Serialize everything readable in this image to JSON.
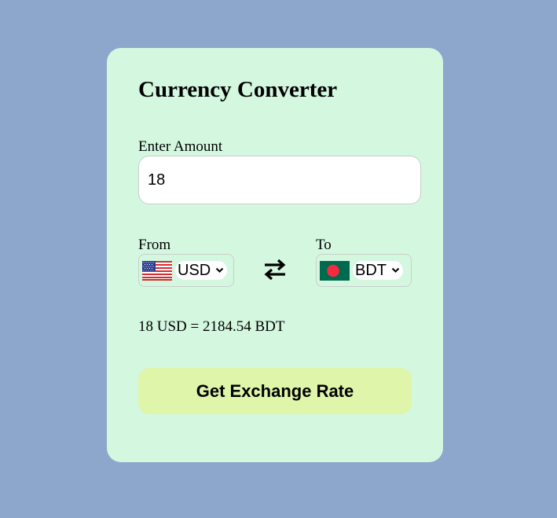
{
  "app": {
    "title": "Currency Converter"
  },
  "amount": {
    "label": "Enter Amount",
    "value": "18"
  },
  "from": {
    "label": "From",
    "currency": "USD",
    "flag": "us-flag-icon"
  },
  "to": {
    "label": "To",
    "currency": "BDT",
    "flag": "bd-flag-icon"
  },
  "swap": {
    "icon": "swap-arrows-icon"
  },
  "result": {
    "text": "18 USD = 2184.54 BDT"
  },
  "button": {
    "label": "Get Exchange Rate"
  },
  "colors": {
    "page_background": "#8da6cc",
    "card_background": "#d4f7e0",
    "button_background": "#dff5aa"
  }
}
